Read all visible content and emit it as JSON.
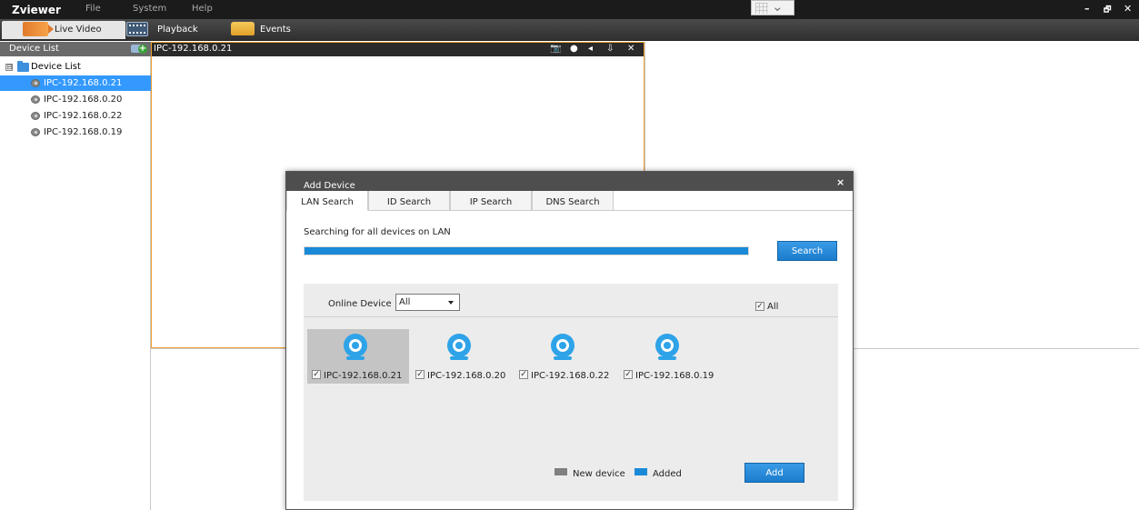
{
  "app": {
    "title": "Zviewer",
    "menu": [
      "File",
      "System",
      "Help"
    ],
    "window_controls": {
      "minimize": "–",
      "restore": "🗗",
      "close": "✕"
    }
  },
  "tabs": [
    {
      "label": "Live Video",
      "icon": "video-camera-icon",
      "active": true
    },
    {
      "label": "Playback",
      "icon": "film-icon",
      "active": false
    },
    {
      "label": "Events",
      "icon": "folder-icon",
      "active": false
    }
  ],
  "device_panel": {
    "header": "Device List",
    "root": "Device List",
    "expander": "⊟",
    "devices": [
      "IPC-192.168.0.21",
      "IPC-192.168.0.20",
      "IPC-192.168.0.22",
      "IPC-192.168.0.19"
    ],
    "selected_index": 0
  },
  "video": {
    "active_channel": "IPC-192.168.0.21",
    "controls": [
      "snapshot-icon",
      "record-icon",
      "speaker-icon",
      "microphone-icon",
      "close-icon"
    ]
  },
  "dialog": {
    "title": "Add Device",
    "close": "×",
    "tabs": [
      "LAN Search",
      "ID Search",
      "IP Search",
      "DNS Search"
    ],
    "active_tab": 0,
    "status": "Searching for all devices on LAN",
    "progress": 1.0,
    "search_button": "Search",
    "filter_label": "Online Device",
    "filter_value": "All",
    "select_all_label": "All",
    "found_devices": [
      {
        "label": "IPC-192.168.0.21",
        "checked": true,
        "selected": true
      },
      {
        "label": "IPC-192.168.0.20",
        "checked": true,
        "selected": false
      },
      {
        "label": "IPC-192.168.0.22",
        "checked": true,
        "selected": false
      },
      {
        "label": "IPC-192.168.0.19",
        "checked": true,
        "selected": false
      }
    ],
    "legend": [
      {
        "label": "New device",
        "color": "#808080"
      },
      {
        "label": "Added",
        "color": "#1a8ad8"
      }
    ],
    "add_button": "Add"
  },
  "colors": {
    "accent": "#1a8ad8",
    "selection": "#3399ff",
    "active_cell_border": "#f0a030"
  }
}
